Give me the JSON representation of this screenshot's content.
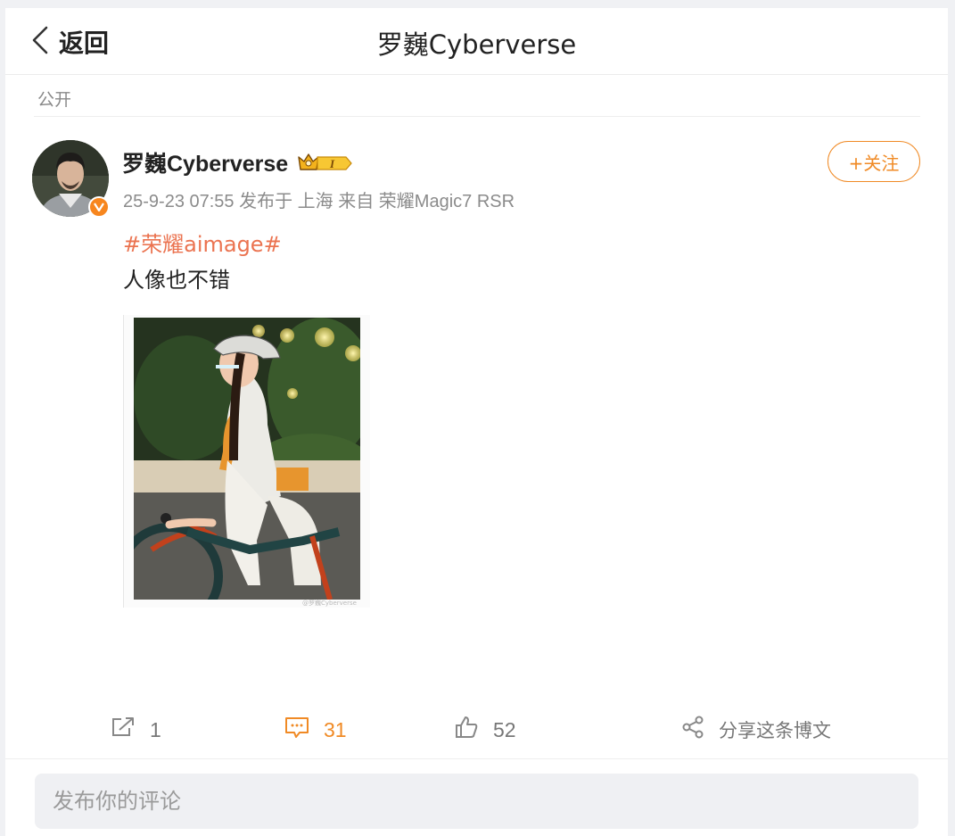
{
  "header": {
    "back_label": "返回",
    "title": "罗巍Cyberverse"
  },
  "post": {
    "visibility": "公开",
    "author": {
      "name": "罗巍Cyberverse",
      "vip_level": "I",
      "verified": true
    },
    "timestamp": "25-9-23 07:55",
    "location": "发布于 上海",
    "source": "来自 荣耀Magic7 RSR",
    "follow_label": "+关注",
    "hashtag": "#荣耀aimage#",
    "text": "人像也不错",
    "image_watermark": "@罗巍Cyberverse"
  },
  "actions": {
    "repost_count": "1",
    "comment_count": "31",
    "like_count": "52",
    "share_label": "分享这条博文"
  },
  "comment_input": {
    "placeholder": "发布你的评论"
  },
  "colors": {
    "accent_orange": "#f08a25",
    "hashtag": "#eb7350",
    "page_bg": "#f0f1f4"
  }
}
